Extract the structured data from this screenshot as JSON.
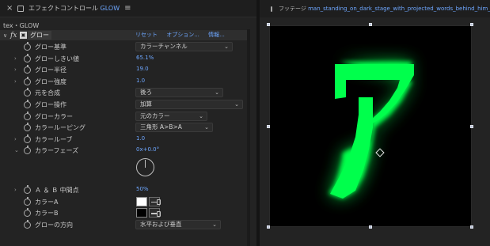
{
  "effect_panel": {
    "tab": {
      "prefix": "エフェクトコントロール",
      "effect_name": "GLOW"
    },
    "layer_path": "tex・GLOW",
    "effect": {
      "name": "グロー",
      "links": [
        "リセット",
        "オプション...",
        "情報..."
      ]
    },
    "properties": [
      {
        "label": "グロー基準",
        "type": "dropdown",
        "value": "カラーチャンネル",
        "expandable": false
      },
      {
        "label": "グローしきい値",
        "type": "number",
        "value": "65.1%",
        "expandable": true
      },
      {
        "label": "グロー半径",
        "type": "number",
        "value": "19.0",
        "expandable": true
      },
      {
        "label": "グロー強度",
        "type": "number",
        "value": "1.0",
        "expandable": true
      },
      {
        "label": "元を合成",
        "type": "dropdown",
        "value": "後ろ",
        "expandable": false
      },
      {
        "label": "グロー操作",
        "type": "dropdown",
        "value": "加算",
        "expandable": false
      },
      {
        "label": "グローカラー",
        "type": "dropdown",
        "value": "元のカラー",
        "expandable": false
      },
      {
        "label": "カラールーピング",
        "type": "dropdown",
        "value": "三角形 A>B>A",
        "expandable": false
      },
      {
        "label": "カラールーブ",
        "type": "number",
        "value": "1.0",
        "expandable": true
      },
      {
        "label": "カラーフェーズ",
        "type": "angle",
        "value": "0x+0.0°",
        "expandable": true
      },
      {
        "label": "Ａ ＆ Ｂ 中間点",
        "type": "number",
        "value": "50%",
        "expandable": true
      },
      {
        "label": "カラーA",
        "type": "color",
        "value": "#ffffff",
        "expandable": false
      },
      {
        "label": "カラーB",
        "type": "color",
        "value": "#000000",
        "expandable": false
      },
      {
        "label": "グローの方向",
        "type": "dropdown",
        "value": "水平および垂直",
        "expandable": false
      }
    ]
  },
  "footage_panel": {
    "tab_prefix": "フッテージ",
    "tab_file": "man_standing_on_dark_stage_with_projected_words_behind_him_by_MXR_"
  },
  "preview": {
    "glyph": "ア",
    "glyph_color": "#00ff4c",
    "glow_color": "#0ec83c",
    "background": "#000000"
  },
  "colors": {
    "accent": "#6ea7ff",
    "panel_bg": "#232323"
  }
}
